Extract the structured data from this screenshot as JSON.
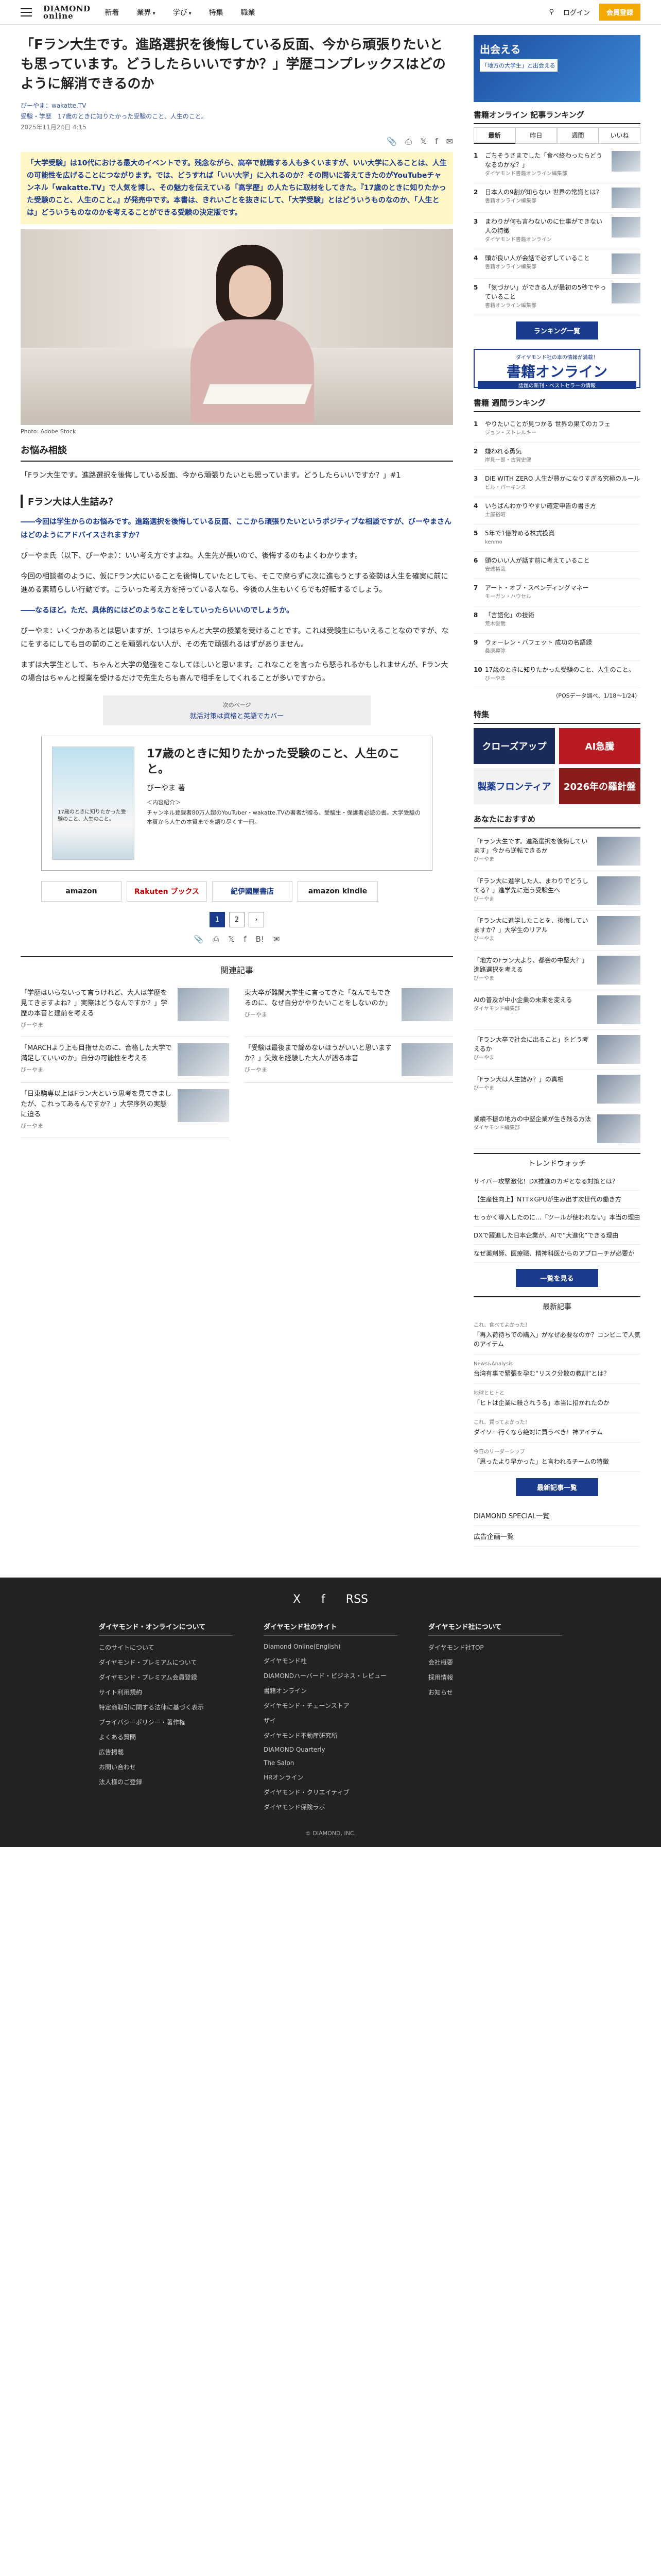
{
  "header": {
    "logo_line1": "DIAMOND",
    "logo_line2": "online",
    "nav": [
      "新着",
      "業界",
      "学び",
      "特集",
      "職業"
    ],
    "login": "ログイン",
    "member_button": "会員登録"
  },
  "article": {
    "title": "「Fラン大生です。進路選択を後悔している反面、今から頑張りたいとも思っています。どうしたらいいですか？」学歴コンプレックスはどのように解消できるのか",
    "author": "びーやま：wakatte.TV",
    "tagline": "受験・学歴　17歳のときに知りたかった受験のこと、人生のこと。",
    "date": "2025年11月24日 4:15",
    "lead": "「大学受験」は10代における最大のイベントです。残念ながら、高卒で就職する人も多くいますが、いい大学に入ることは、人生の可能性を広げることにつながります。では、どうすれば「いい大学」に入れるのか？その問いに答えてきたのがYouTubeチャンネル「wakatte.TV」で人気を博し、その魅力を伝えている「高学歴」の人たちに取材をしてきた。『17歳のときに知りたかった受験のこと、人生のこと。』が発売中です。本書は、きれいごとを抜きにして、「大学受験」とはどういうものなのか、「人生とは」どういうものなのかを考えることができる受験の決定版です。",
    "photo_caption": "Photo: Adobe Stock",
    "section1_title": "お悩み相談",
    "question": "「Fラン大生です。進路選択を後悔している反面、今から頑張りたいとも思っています。どうしたらいいですか？」#1",
    "subhead1": "Fラン大は人生詰み？",
    "q1": "――今回は学生からのお悩みです。進路選択を後悔している反面、ここから頑張りたいというポジティブな相談ですが、びーやまさんはどのようにアドバイスされますか？",
    "a1": "びーやま氏（以下、びーやま）：いい考え方ですよね。人生先が長いので、後悔するのもよくわかります。",
    "a2": "今回の相談者のように、仮にFラン大にいることを後悔していたとしても、そこで腐らずに次に進もうとする姿勢は人生を確実に前に進める素晴らしい行動です。こういった考え方を持っている人なら、今後の人生もいくらでも好転するでしょう。",
    "q2": "――なるほど。ただ、具体的にはどのようなことをしていったらいいのでしょうか。",
    "a3": "びーやま：いくつかあるとは思いますが、1つはちゃんと大学の授業を受けることです。これは受験生にもいえることなのですが、なにをするにしても目の前のことを頑張れない人が、その先で頑張れるはずがありません。",
    "a4": "まずは大学生として、ちゃんと大学の勉強をこなしてほしいと思います。これなことを言ったら怒られるかもしれませんが、Fラン大の場合はちゃんと授業を受けるだけで先生たちも喜んで相手をしてくれることが多いですから。",
    "next_label": "次のページ",
    "next_title": "就活対策は資格と英語でカバー"
  },
  "book": {
    "title": "17歳のときに知りたかった受験のこと、人生のこと。",
    "author": "びーやま 著",
    "cover_text": "17歳のときに知りたかった受験のこと、人生のこと。",
    "desc_label": "＜内容紹介＞",
    "desc": "チャンネル登録者80万人超のYouTuber・wakatte.TVの著者が贈る、受験生・保護者必読の書。大学受験の本質から人生の本質までを語り尽くす一冊。",
    "stores": [
      "amazon",
      "Rakuten ブックス",
      "紀伊國屋書店",
      "amazon kindle"
    ],
    "pages": [
      "1",
      "2"
    ]
  },
  "related": {
    "heading": "関連記事",
    "items": [
      {
        "title": "「学歴はいらないって言うけれど、大人は学歴を見てきますよね？」実際はどうなんですか？」学歴の本音と建前を考える",
        "author": "びーやま"
      },
      {
        "title": "東大卒が難関大学生に言ってきた「なんでもできるのに、なぜ自分がやりたいことをしないのか」",
        "author": "びーやま"
      },
      {
        "title": "「MARCHより上も目指せたのに、合格した大学で満足していいのか」自分の可能性を考える",
        "author": "びーやま"
      },
      {
        "title": "「受験は最後まで諦めないほうがいいと思いますか？」失敗を経験した大人が語る本音",
        "author": "びーやま"
      },
      {
        "title": "「日東駒専以上はFラン大という思考を見てきましたが、これってあるんですか？」大学序列の実態に迫る",
        "author": "びーやま"
      }
    ]
  },
  "sidebar": {
    "ad_title": "出会える",
    "ad_sub": "「地方の大学生」と出会える",
    "ranking_heading": "書籍オンライン 記事ランキング",
    "tabs": [
      "最新",
      "昨日",
      "週間",
      "いいね"
    ],
    "ranking": [
      {
        "n": "1",
        "title": "ごちそうさまでした「食べ終わったらどうなるのかな？」",
        "sub": "ダイヤモンド書籍オンライン編集部"
      },
      {
        "n": "2",
        "title": "日本人の9割が知らない 世界の常識とは？",
        "sub": "書籍オンライン編集部"
      },
      {
        "n": "3",
        "title": "まわりが何も言わないのに仕事ができない人の特徴",
        "sub": "ダイヤモンド書籍オンライン"
      },
      {
        "n": "4",
        "title": "頭が良い人が会話で必ずしていること",
        "sub": "書籍オンライン編集部"
      },
      {
        "n": "5",
        "title": "「気づかい」ができる人が最初の5秒でやっていること",
        "sub": "書籍オンライン編集部"
      }
    ],
    "ranking_button": "ランキング一覧",
    "books_ad_1": "ダイヤモンド社の本の情報が満載！",
    "books_ad_2": "書籍オンライン",
    "books_ad_3": "話題の新刊・ベストセラーの情報",
    "weekly_heading": "書籍 週間ランキング",
    "weekly": [
      {
        "n": "1",
        "title": "やりたいことが見つかる 世界の果てのカフェ",
        "sub": "ジョン・ストレルキー"
      },
      {
        "n": "2",
        "title": "嫌われる勇気",
        "sub": "岸見一郎・古賀史健"
      },
      {
        "n": "3",
        "title": "DIE WITH ZERO 人生が豊かになりすぎる究極のルール",
        "sub": "ビル・パーキンス"
      },
      {
        "n": "4",
        "title": "いちばんわかりやすい確定申告の書き方",
        "sub": "土屋裕昭"
      },
      {
        "n": "5",
        "title": "5年で1億貯める株式投資",
        "sub": "kenmo"
      },
      {
        "n": "6",
        "title": "頭のいい人が話す前に考えていること",
        "sub": "安達裕哉"
      },
      {
        "n": "7",
        "title": "アート・オブ・スペンディングマネー",
        "sub": "モーガン・ハウセル"
      },
      {
        "n": "8",
        "title": "「言語化」の技術",
        "sub": "荒木俊哉"
      },
      {
        "n": "9",
        "title": "ウォーレン・バフェット 成功の名語録",
        "sub": "桑原晃弥"
      },
      {
        "n": "10",
        "title": "17歳のときに知りたかった受験のこと、人生のこと。",
        "sub": "びーやま"
      }
    ],
    "weekly_note": "（POSデータ調べ、1/18〜1/24）",
    "feature_heading": "特集",
    "features": [
      "クローズアップ",
      "AI急騰",
      "製薬フロンティア",
      "2026年の羅針盤"
    ],
    "recommend_heading": "あなたにおすすめ",
    "recommends": [
      {
        "title": "「Fラン大生です。進路選択を後悔しています」今から逆転できるか",
        "sub": "びーやま"
      },
      {
        "title": "「Fラン大に進学した人、まわりでどうしてる？」進学先に迷う受験生へ",
        "sub": "びーやま"
      },
      {
        "title": "「Fラン大に進学したことを、後悔していますか？」大学生のリアル",
        "sub": "びーやま"
      },
      {
        "title": "「地方のFラン大より、都会の中堅大？」進路選択を考える",
        "sub": "びーやま"
      },
      {
        "title": "AIの普及が中小企業の未来を変える",
        "sub": "ダイヤモンド編集部"
      },
      {
        "title": "「Fラン大卒で社会に出ること」をどう考えるか",
        "sub": "びーやま"
      },
      {
        "title": "「Fラン大は人生詰み？」の真相",
        "sub": "びーやま"
      },
      {
        "title": "業績不振の地方の中堅企業が生き残る方法",
        "sub": "ダイヤモンド編集部"
      }
    ],
    "trend_heading": "トレンドウォッチ",
    "trends": [
      "サイバー攻撃激化！DX推進のカギとなる対策とは？",
      "【生産性向上】NTT×GPUが生み出す次世代の働き方",
      "せっかく導入したのに…「ツールが使われない」本当の理由",
      "DXで躍進した日本企業が、AIで“大進化”できる理由",
      "なぜ薬剤師、医療職、精神科医からのアプローチが必要か"
    ],
    "trend_button": "一覧を見る",
    "newest_heading": "最新記事",
    "newest": [
      {
        "tag": "これ、食べてよかった！",
        "title": "「再入荷待ちでの購入」がなぜ必要なのか？コンビニで人気のアイテム"
      },
      {
        "tag": "News&Analysis",
        "title": "台湾有事で緊張を孕む“リスク分散の教訓”とは？"
      },
      {
        "tag": "地球とヒトと",
        "title": "「ヒトは企業に殺されうる」本当に招かれたのか"
      },
      {
        "tag": "これ、買ってよかった！",
        "title": "ダイソー行くなら絶対に買うべき！神アイテム"
      },
      {
        "tag": "今日のリーダーシップ",
        "title": "「思ったより早かった」と言われるチームの特徴"
      }
    ],
    "newest_button": "最新記事一覧",
    "links": [
      "DIAMOND SPECIAL一覧",
      "広告企画一覧"
    ]
  },
  "footer": {
    "social": [
      "X",
      "f",
      "RSS"
    ],
    "col1_title": "ダイヤモンド・オンラインについて",
    "col1": [
      "このサイトについて",
      "ダイヤモンド・プレミアムについて",
      "ダイヤモンド・プレミアム会員登録",
      "サイト利用規約",
      "特定商取引に関する法律に基づく表示",
      "プライバシーポリシー・著作権",
      "よくある質問",
      "広告掲載",
      "お問い合わせ",
      "法人様のご登録"
    ],
    "col2_title": "ダイヤモンド社のサイト",
    "col2": [
      "Diamond Online(English)",
      "ダイヤモンド社",
      "DIAMONDハーバード・ビジネス・レビュー",
      "書籍オンライン",
      "ダイヤモンド・チェーンストア",
      "ザイ",
      "ダイヤモンド不動産研究所",
      "DIAMOND Quarterly",
      "The Salon",
      "HRオンライン",
      "ダイヤモンド・クリエイティブ",
      "ダイヤモンド保険ラボ"
    ],
    "col3_title": "ダイヤモンド社について",
    "col3": [
      "ダイヤモンド社TOP",
      "会社概要",
      "採用情報",
      "お知らせ"
    ],
    "copyright": "© DIAMOND, INC."
  }
}
